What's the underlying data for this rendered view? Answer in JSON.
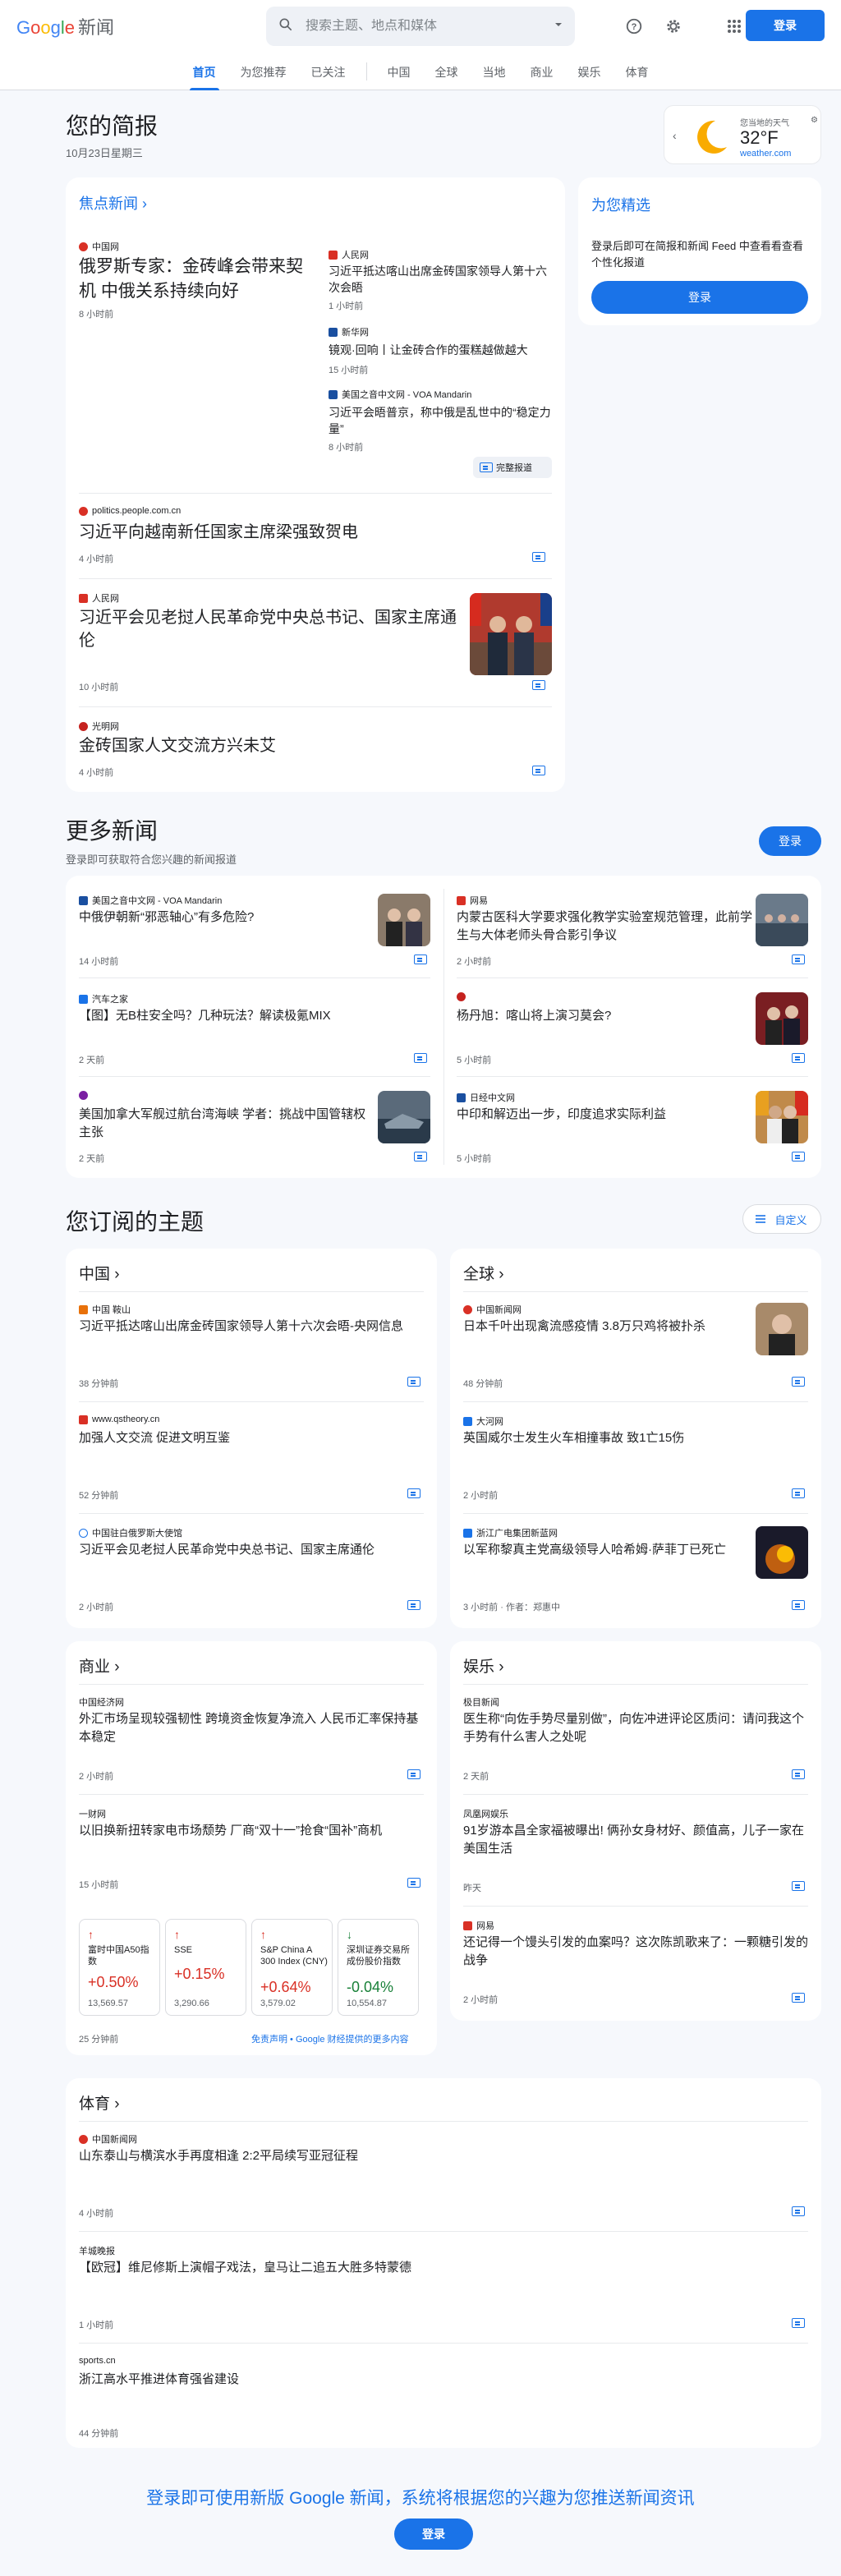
{
  "header": {
    "logo_google": "Google",
    "logo_news": "新闻",
    "search_placeholder": "搜索主题、地点和媒体",
    "signin": "登录"
  },
  "nav": {
    "items": [
      "首页",
      "为您推荐",
      "已关注",
      "中国",
      "全球",
      "当地",
      "商业",
      "娱乐",
      "体育"
    ]
  },
  "briefing": {
    "title": "您的简报",
    "date": "10月23日星期三"
  },
  "weather": {
    "label": "您当地的天气",
    "temp": "32°F",
    "source": "weather.com"
  },
  "top_stories": {
    "title": "焦点新闻",
    "main": {
      "source": "中国网",
      "headline": "俄罗斯专家：金砖峰会带来契机 中俄关系持续向好",
      "time": "8 小时前"
    },
    "side": [
      {
        "source": "人民网",
        "headline": "习近平抵达喀山出席金砖国家领导人第十六次会晤",
        "time": "1 小时前"
      },
      {
        "source": "新华网",
        "headline": "镜观·回响丨让金砖合作的蛋糕越做越大",
        "time": "15 小时前"
      },
      {
        "source": "美国之音中文网 - VOA Mandarin",
        "headline": "习近平会晤普京，称中俄是乱世中的“稳定力量”",
        "time": "8 小时前"
      }
    ],
    "full_coverage": "完整报道",
    "stories": [
      {
        "source": "politics.people.com.cn",
        "headline": "习近平向越南新任国家主席梁强致贺电",
        "time": "4 小时前"
      },
      {
        "source": "人民网",
        "headline": "习近平会见老挝人民革命党中央总书记、国家主席通伦",
        "time": "10 小时前"
      },
      {
        "source": "光明网",
        "headline": "金砖国家人文交流方兴未艾",
        "time": "4 小时前"
      }
    ]
  },
  "for_you": {
    "title": "为您精选",
    "text": "登录后即可在简报和新闻 Feed 中查看看查看个性化报道",
    "button": "登录"
  },
  "more_news": {
    "title": "更多新闻",
    "subtitle": "登录即可获取符合您兴趣的新闻报道",
    "button": "登录",
    "items": [
      {
        "source": "美国之音中文网 - VOA Mandarin",
        "headline": "中俄伊朝新“邪恶轴心”有多危险?",
        "time": "14 小时前"
      },
      {
        "source": "网易",
        "headline": "内蒙古医科大学要求强化教学实验室规范管理，此前学生与大体老师头骨合影引争议",
        "time": "2 小时前"
      },
      {
        "source": "汽车之家",
        "headline": "【图】无B柱安全吗？几种玩法？解读极氪MIX",
        "time": "2 天前"
      },
      {
        "source": "",
        "headline": "杨丹旭：喀山将上演习莫会?",
        "time": "5 小时前"
      },
      {
        "source": "",
        "headline": "美国加拿大军舰过航台湾海峡 学者：挑战中国管辖权主张",
        "time": "2 天前"
      },
      {
        "source": "日经中文网",
        "headline": "中印和解迈出一步，印度追求实际利益",
        "time": "5 小时前"
      }
    ]
  },
  "topics": {
    "title": "您订阅的主题",
    "customize": "自定义",
    "china": {
      "title": "中国",
      "items": [
        {
          "source": "中国 鞍山",
          "headline": "习近平抵达喀山出席金砖国家领导人第十六次会晤-央网信息",
          "time": "38 分钟前"
        },
        {
          "source": "www.qstheory.cn",
          "headline": "加强人文交流 促进文明互鉴",
          "time": "52 分钟前"
        },
        {
          "source": "中国驻白俄罗斯大使馆",
          "headline": "习近平会见老挝人民革命党中央总书记、国家主席通伦",
          "time": "2 小时前"
        }
      ]
    },
    "world": {
      "title": "全球",
      "items": [
        {
          "source": "中国新闻网",
          "headline": "日本千叶出现禽流感疫情 3.8万只鸡将被扑杀",
          "time": "48 分钟前"
        },
        {
          "source": "大河网",
          "headline": "英国威尔士发生火车相撞事故 致1亡15伤",
          "time": "2 小时前"
        },
        {
          "source": "浙江广电集团新蓝网",
          "headline": "以军称黎真主党高级领导人哈希姆·萨菲丁已死亡",
          "time": "3 小时前 · 作者：郑惠中"
        }
      ]
    },
    "business": {
      "title": "商业",
      "items": [
        {
          "source": "中国经济网",
          "headline": "外汇市场呈现较强韧性 跨境资金恢复净流入 人民币汇率保持基本稳定",
          "time": "2 小时前"
        },
        {
          "source": "一财网",
          "headline": "以旧换新扭转家电市场颓势 厂商“双十一”抢食“国补”商机",
          "time": "15 小时前"
        }
      ],
      "stocks": [
        {
          "name": "富时中国A50指数",
          "change": "+0.50%",
          "value": "13,569.57",
          "dir": "up"
        },
        {
          "name": "SSE",
          "change": "+0.15%",
          "value": "3,290.66",
          "dir": "up"
        },
        {
          "name": "S&P China A 300 Index (CNY)",
          "change": "+0.64%",
          "value": "3,579.02",
          "dir": "up"
        },
        {
          "name": "深圳证券交易所成份股价指数",
          "change": "-0.04%",
          "value": "10,554.87",
          "dir": "down"
        }
      ],
      "stock_time": "25 分钟前",
      "disclaimer": "免责声明 • Google 财经提供的更多内容"
    },
    "entertainment": {
      "title": "娱乐",
      "items": [
        {
          "source": "极目新闻",
          "headline": "医生称“向佐手势尽量别做”，向佐冲进评论区质问：请问我这个手势有什么害人之处呢",
          "time": "2 天前"
        },
        {
          "source": "凤凰网娱乐",
          "headline": "91岁游本昌全家福被曝出! 俩孙女身材好、颜值高，儿子一家在美国生活",
          "time": "昨天"
        },
        {
          "source": "网易",
          "headline": "还记得一个馒头引发的血案吗？这次陈凯歌来了：一颗糖引发的战争",
          "time": "2 小时前"
        }
      ]
    },
    "sports": {
      "title": "体育",
      "items": [
        {
          "source": "中国新闻网",
          "headline": "山东泰山与横滨水手再度相逢 2:2平局续写亚冠征程",
          "time": "4 小时前"
        },
        {
          "source": "羊城晚报",
          "headline": "【欧冠】维尼修斯上演帽子戏法，皇马让二追五大胜多特蒙德",
          "time": "1 小时前"
        },
        {
          "source": "sports.cn",
          "headline": "浙江高水平推进体育强省建设",
          "time": "44 分钟前"
        }
      ]
    }
  },
  "footer": {
    "message": "登录即可使用新版 Google 新闻，系统将根据您的兴趣为您推送新闻资讯",
    "button": "登录"
  }
}
